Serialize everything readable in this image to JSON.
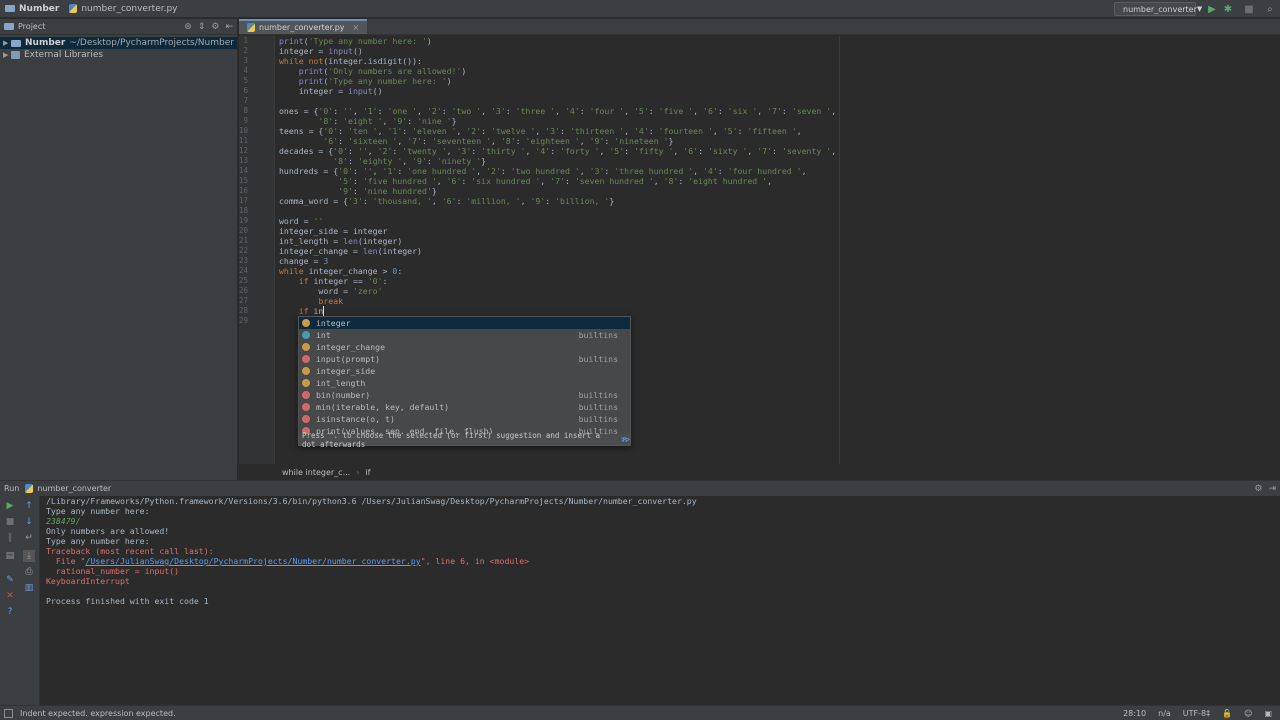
{
  "navbar": {
    "project": "Number",
    "file": "number_converter.py",
    "run_config": "number_converter"
  },
  "project_panel": {
    "title": "Project",
    "root_name": "Number",
    "root_path": "~/Desktop/PycharmProjects/Number",
    "external_libraries": "External Libraries"
  },
  "editor": {
    "tab": "number_converter.py",
    "line_numbers": [
      "1",
      "2",
      "3",
      "4",
      "5",
      "6",
      "7",
      "8",
      "9",
      "10",
      "11",
      "12",
      "13",
      "14",
      "15",
      "16",
      "17",
      "18",
      "19",
      "20",
      "21",
      "22",
      "23",
      "24",
      "25",
      "26",
      "27",
      "28",
      "29"
    ],
    "breadcrumb": [
      "while integer_c...",
      "if"
    ]
  },
  "completion": {
    "items": [
      {
        "icon": "v",
        "name": "integer",
        "type": ""
      },
      {
        "icon": "c",
        "name": "int",
        "type": "builtins"
      },
      {
        "icon": "v",
        "name": "integer_change",
        "type": ""
      },
      {
        "icon": "f",
        "name": "input(prompt)",
        "type": "builtins"
      },
      {
        "icon": "v",
        "name": "integer_side",
        "type": ""
      },
      {
        "icon": "v",
        "name": "int_length",
        "type": ""
      },
      {
        "icon": "f",
        "name": "bin(number)",
        "type": "builtins"
      },
      {
        "icon": "f",
        "name": "min(iterable, key, default)",
        "type": "builtins"
      },
      {
        "icon": "f",
        "name": "isinstance(o, t)",
        "type": "builtins"
      },
      {
        "icon": "f",
        "name": "print(values, sep, end, file, flush)",
        "type": "builtins"
      }
    ],
    "hint": "Press ^. to choose the selected (or first) suggestion and insert a dot afterwards",
    "hint_link": ">>",
    "pi": "π"
  },
  "run": {
    "label": "Run",
    "config": "number_converter",
    "lines": [
      {
        "kind": "normal",
        "text": "/Library/Frameworks/Python.framework/Versions/3.6/bin/python3.6 /Users/JulianSwag/Desktop/PycharmProjects/Number/number_converter.py"
      },
      {
        "kind": "normal",
        "text": "Type any number here:"
      },
      {
        "kind": "input",
        "text": "238479/"
      },
      {
        "kind": "normal",
        "text": "Only numbers are allowed!"
      },
      {
        "kind": "normal",
        "text": "Type any number here:"
      },
      {
        "kind": "err",
        "text": "Traceback (most recent call last):"
      },
      {
        "kind": "err",
        "text": "  rational_number = input()"
      },
      {
        "kind": "err",
        "text": "KeyboardInterrupt"
      },
      {
        "kind": "normal",
        "text": ""
      },
      {
        "kind": "normal",
        "text": "Process finished with exit code 1"
      }
    ],
    "file_line_prefix": "  File \"",
    "file_line_link": "/Users/JulianSwag/Desktop/PycharmProjects/Number/number_converter.py",
    "file_line_suffix": "\", line 6, in <module>"
  },
  "status": {
    "message": "Indent expected. expression expected.",
    "position": "28:10",
    "line_sep": "n/a",
    "encoding": "UTF-8‡"
  }
}
